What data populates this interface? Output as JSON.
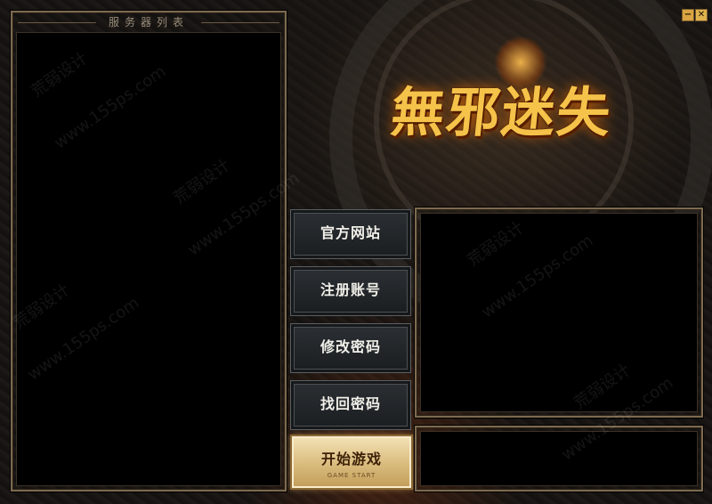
{
  "server_panel": {
    "title": "服务器列表"
  },
  "buttons": {
    "official_site": "官方网站",
    "register": "注册账号",
    "change_password": "修改密码",
    "recover_password": "找回密码",
    "start_game": "开始游戏",
    "start_game_sub": "GAME START"
  },
  "logo": {
    "title": "無邪迷失"
  },
  "window": {
    "minimize": "−",
    "close": "✕"
  },
  "watermark": {
    "name": "荒弱设计",
    "url": "www.155ps.com"
  },
  "colors": {
    "accent": "#f6c34a",
    "frame": "#7d6a4f",
    "start_button": "#d9bb7d"
  }
}
